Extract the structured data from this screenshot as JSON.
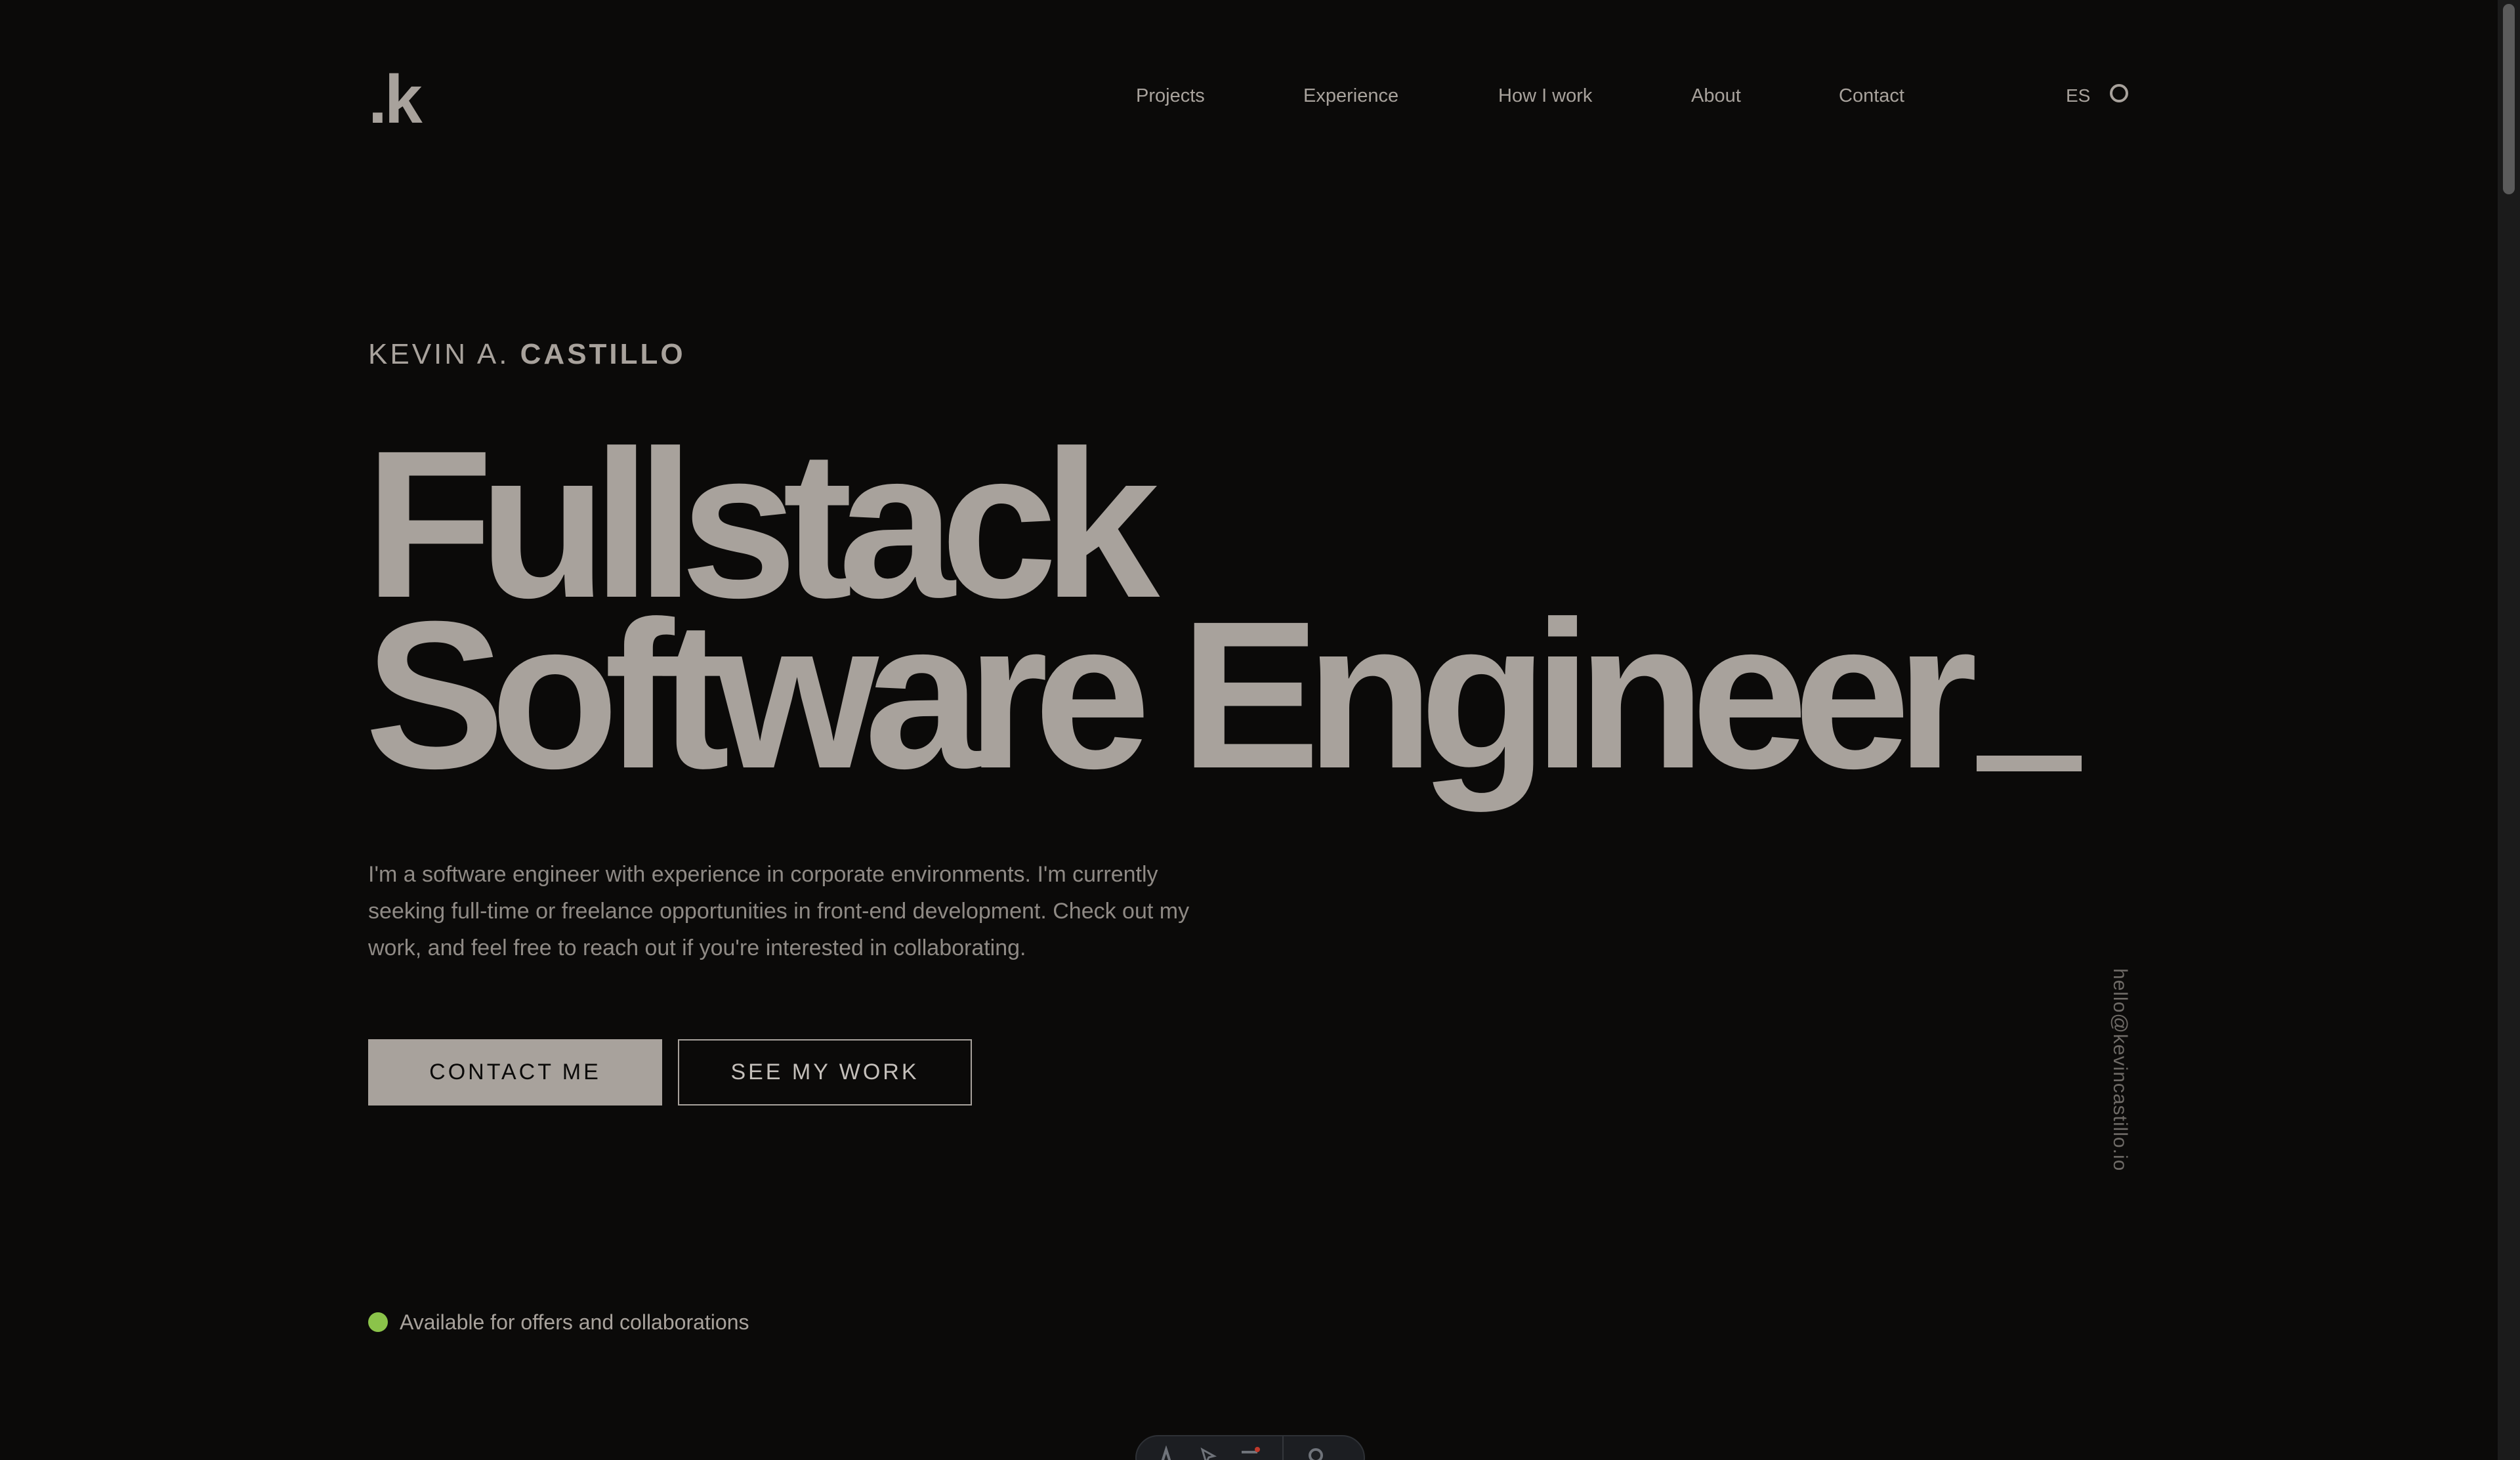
{
  "header": {
    "logo_text": ".k",
    "nav": [
      {
        "label": "Projects"
      },
      {
        "label": "Experience"
      },
      {
        "label": "How I work"
      },
      {
        "label": "About"
      },
      {
        "label": "Contact"
      }
    ],
    "language_toggle": "ES",
    "theme_toggle_icon": "circle-icon"
  },
  "hero": {
    "name_first": "KEVIN A.",
    "name_last": "CASTILLO",
    "headline_line1": "Fullstack",
    "headline_line2": "Software Engineer",
    "intro": "I'm a software engineer with experience in corporate environments. I'm currently seeking full-time or freelance opportunities in front-end development. Check out my work, and feel free to reach out if you're interested in collaborating.",
    "primary_cta": "CONTACT ME",
    "secondary_cta": "SEE MY WORK",
    "email": "hello@kevincastillo.io",
    "availability": "Available for offers and collaborations"
  },
  "colors": {
    "background": "#0b0a09",
    "text": "#a8a29c",
    "status_available": "#8bc34a"
  },
  "dock": {
    "icons": [
      "accessibility-icon",
      "pointer-icon",
      "menu-icon",
      "settings-icon"
    ]
  }
}
